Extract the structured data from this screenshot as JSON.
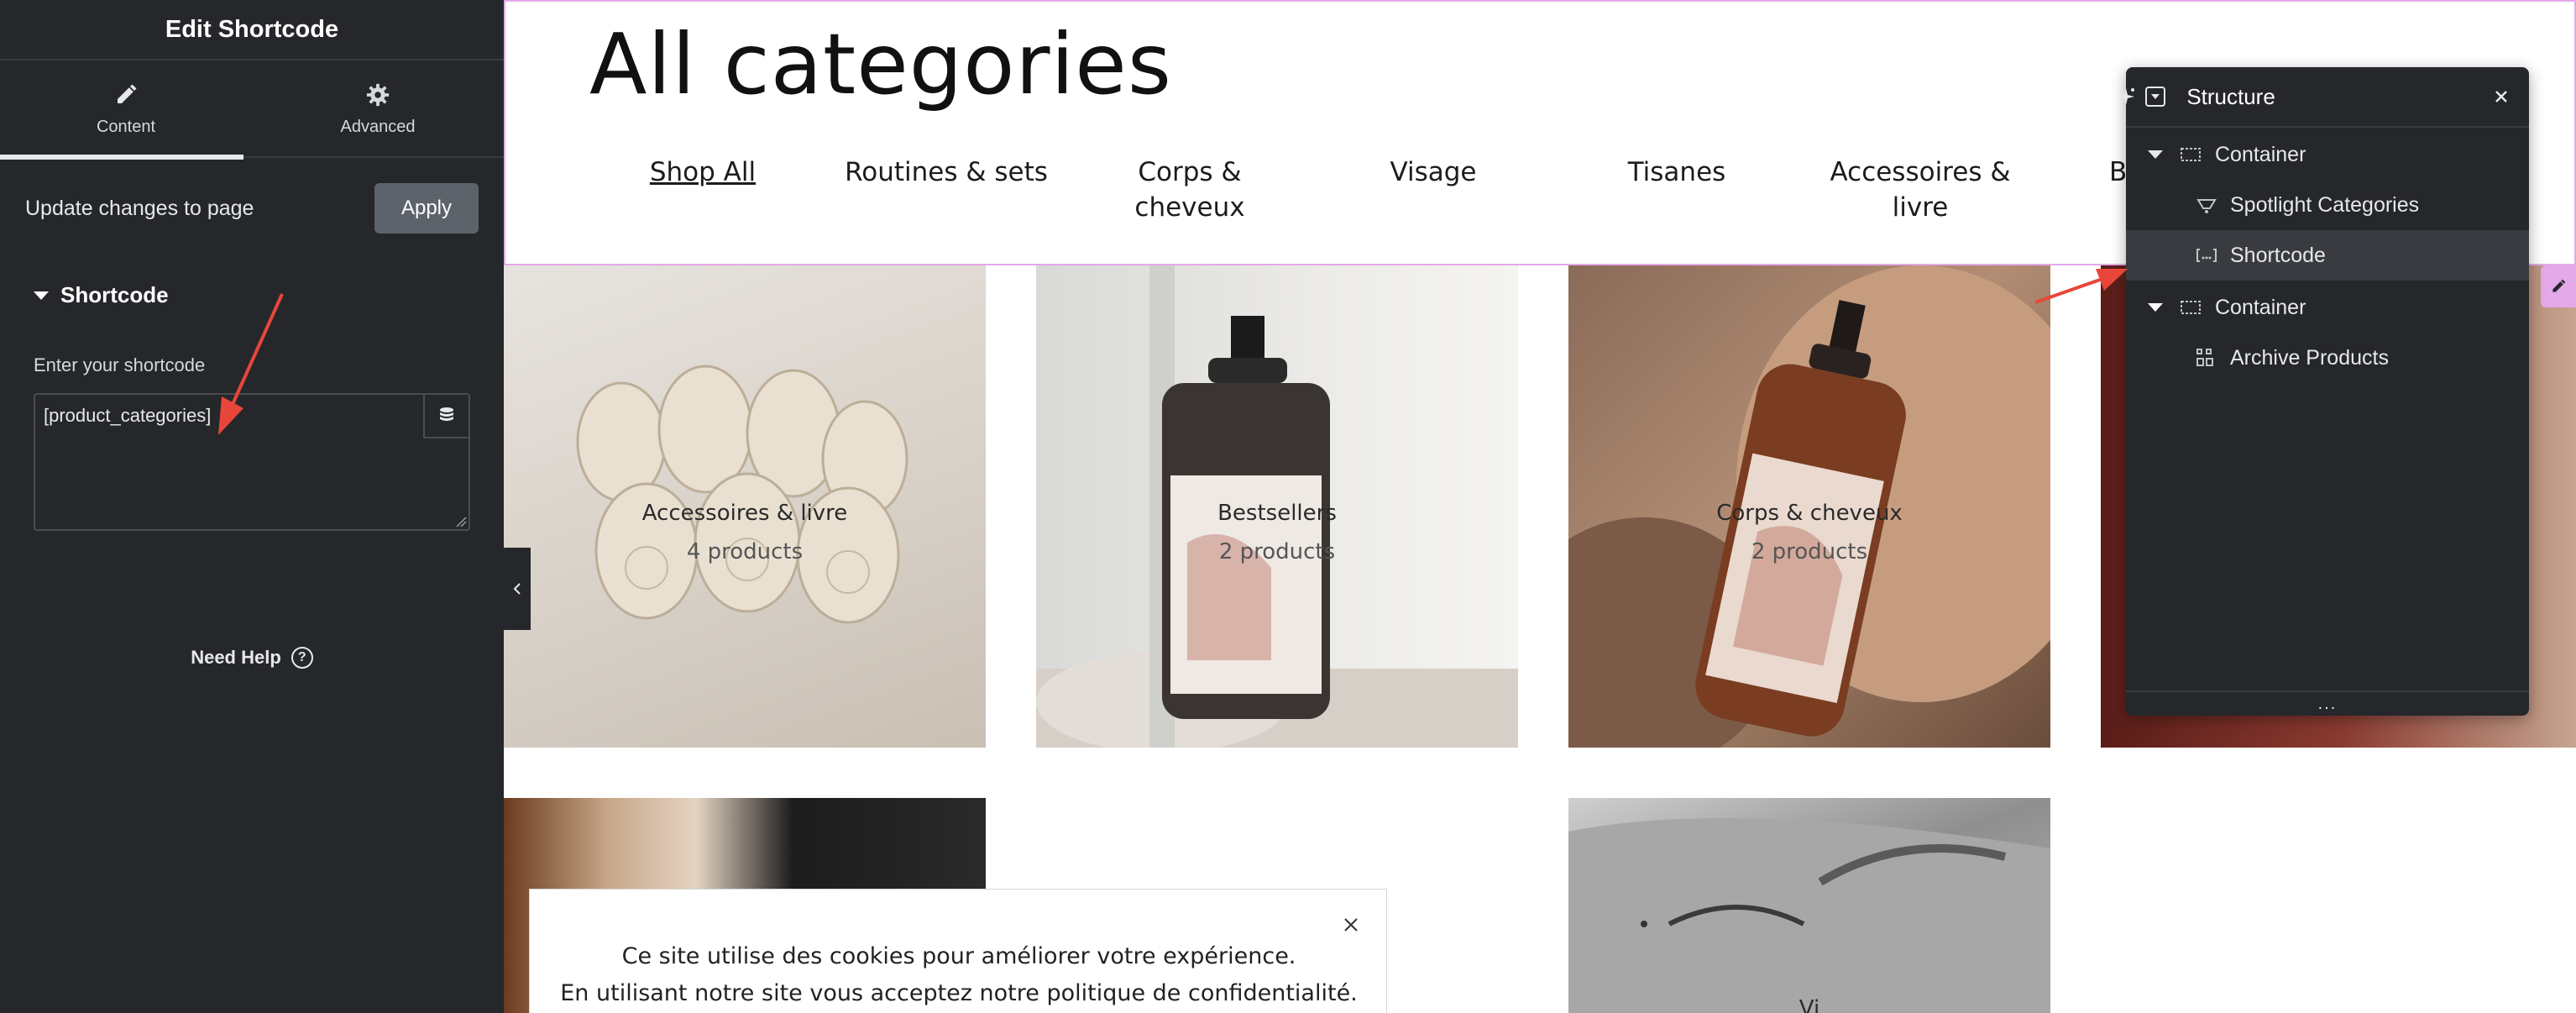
{
  "editor": {
    "title": "Edit Shortcode",
    "tabs": [
      {
        "label": "Content",
        "icon": "pencil-icon"
      },
      {
        "label": "Advanced",
        "icon": "gear-icon"
      }
    ],
    "update_text": "Update changes to page",
    "apply_label": "Apply",
    "section_title": "Shortcode",
    "field_label": "Enter your shortcode",
    "shortcode_value": "[product_categories]",
    "need_help": "Need Help",
    "help_icon": "?"
  },
  "preview": {
    "heading": "All categories",
    "categories": [
      {
        "line1": "Shop All",
        "line2": ""
      },
      {
        "line1": "Routines & sets",
        "line2": ""
      },
      {
        "line1": "Corps &",
        "line2": "cheveux"
      },
      {
        "line1": "Visage",
        "line2": ""
      },
      {
        "line1": "Tisanes",
        "line2": ""
      },
      {
        "line1": "Accessoires &",
        "line2": "livre"
      },
      {
        "line1": "Bes",
        "line2": ""
      }
    ],
    "tiles": [
      {
        "name": "Accessoires & livre",
        "count": "4 products"
      },
      {
        "name": "Bestsellers",
        "count": "2 products"
      },
      {
        "name": "Corps & cheveux",
        "count": "2 products"
      },
      {
        "name": "",
        "count": ""
      }
    ],
    "lower_tile_label": "Vi"
  },
  "structure": {
    "title": "Structure",
    "items": [
      {
        "label": "Container",
        "level": 0,
        "icon": "container-icon"
      },
      {
        "label": "Spotlight Categories",
        "level": 1,
        "icon": "spotlight-icon"
      },
      {
        "label": "Shortcode",
        "level": 1,
        "icon": "shortcode-icon"
      },
      {
        "label": "Container",
        "level": 0,
        "icon": "container-icon"
      },
      {
        "label": "Archive Products",
        "level": 1,
        "icon": "archive-icon"
      }
    ],
    "footer": "..."
  },
  "cookie": {
    "line1": "Ce site utilise des cookies pour améliorer votre expérience.",
    "line2": "En utilisant notre site vous acceptez notre politique de confidentialité."
  },
  "colors": {
    "panel_bg": "#26272b",
    "accent_pink": "#e3a9e9",
    "arrow_red": "#e8463a"
  }
}
